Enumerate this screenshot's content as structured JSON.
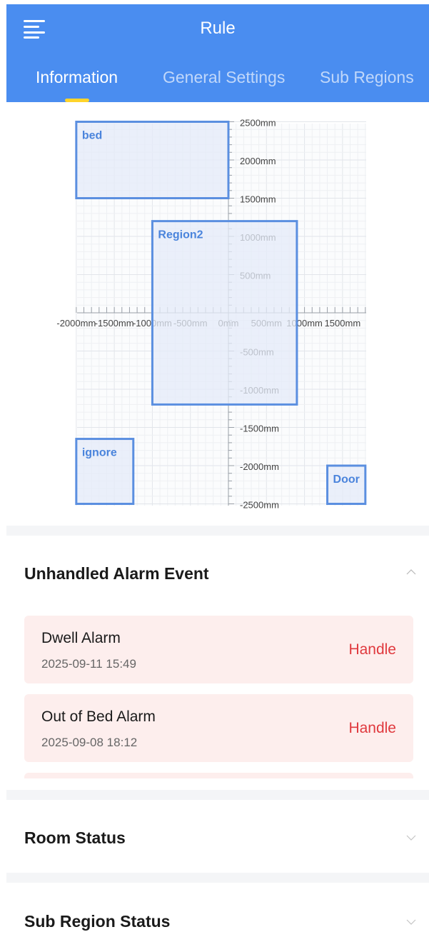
{
  "header": {
    "title": "Rule",
    "tabs": [
      {
        "label": "Information",
        "active": true
      },
      {
        "label": "General Settings",
        "active": false
      },
      {
        "label": "Sub Regions",
        "active": false
      }
    ]
  },
  "map": {
    "x_unit": "mm",
    "y_unit": "mm",
    "x_tick_labels": [
      "-2000mm",
      "-1500mm",
      "-1000mm",
      "-500mm",
      "0mm",
      "500mm",
      "1000mm",
      "1500mm"
    ],
    "y_tick_labels": [
      "2500mm",
      "2000mm",
      "1500mm",
      "1000mm",
      "500mm",
      "-500mm",
      "-1000mm",
      "-1500mm",
      "-2000mm",
      "-2500mm"
    ],
    "regions": [
      {
        "name": "bed",
        "x_min": -2000,
        "x_max": 0,
        "y_min": 1500,
        "y_max": 2500
      },
      {
        "name": "Region2",
        "x_min": -1000,
        "x_max": 900,
        "y_min": -1200,
        "y_max": 1200
      },
      {
        "name": "ignore",
        "x_min": -2000,
        "x_max": -1250,
        "y_min": -2500,
        "y_max": -1650
      },
      {
        "name": "Door",
        "x_min": 1300,
        "x_max": 1800,
        "y_min": -2500,
        "y_max": -2000
      }
    ],
    "colors": {
      "region_stroke": "#5b8fe0",
      "region_fill": "#e4ebf8",
      "label": "#4a84dc"
    }
  },
  "alarm_section": {
    "title": "Unhandled Alarm Event",
    "events": [
      {
        "name": "Dwell Alarm",
        "time": "2025-09-11 15:49",
        "action": "Handle"
      },
      {
        "name": "Out of Bed Alarm",
        "time": "2025-09-08 18:12",
        "action": "Handle"
      }
    ]
  },
  "room_status": {
    "title": "Room Status"
  },
  "sub_region_status": {
    "title": "Sub Region Status"
  },
  "colors": {
    "accent": "#4a8df0",
    "indicator": "#ffd42a",
    "alarm_bg": "#fdeeed",
    "alarm_action": "#e0393e"
  }
}
